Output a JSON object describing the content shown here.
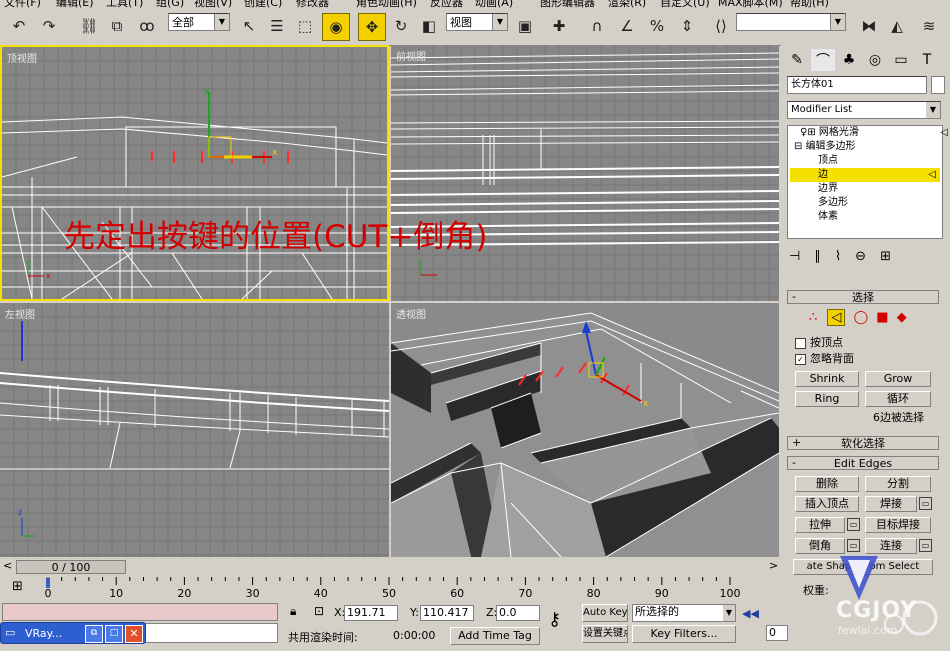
{
  "menu": [
    "文件(F)",
    "编辑(E)",
    "工具(T)",
    "组(G)",
    "视图(V)",
    "创建(C)",
    "修改器",
    "角色动画(H)",
    "反应器",
    "动画(A)",
    "图形编辑器",
    "渲染(R)",
    "自定义(U)",
    "MAX脚本(M)",
    "帮助(H)"
  ],
  "toolbar": {
    "selection_filter": "全部",
    "ref_coord": "视图",
    "named_selection": ""
  },
  "viewports": {
    "top_label": "顶视图",
    "front_label": "前视图",
    "left_label": "左视图",
    "persp_label": "透视图",
    "overlay_text": "先定出按键的位置(CUT+倒角)"
  },
  "command_panel": {
    "object_name": "长方体01",
    "modifier_list": "Modifier List",
    "stack": [
      "网格光滑",
      "编辑多边形",
      "顶点",
      "边",
      "边界",
      "多边形",
      "体素"
    ],
    "selection_rollout": "选择",
    "by_vertex": "按顶点",
    "ignore_backfacing": "忽略背面",
    "shrink": "Shrink",
    "grow": "Grow",
    "ring": "Ring",
    "loop": "循环",
    "selection_info": "6边被选择",
    "soft_selection": "软化选择",
    "edit_edges": "Edit Edges",
    "remove": "删除",
    "split": "分割",
    "insert_vertex": "插入顶点",
    "weld": "焊接",
    "extrude": "拉伸",
    "target_weld": "目标焊接",
    "chamfer": "倒角",
    "connect": "连接",
    "create_shape": "ate Shape From Select",
    "weight": "权重:"
  },
  "timeline": {
    "frame": "0 / 100",
    "ticks": [
      "0",
      "10",
      "20",
      "30",
      "40",
      "50",
      "60",
      "70",
      "80",
      "90",
      "100"
    ]
  },
  "status": {
    "x_label": "X:",
    "x_value": "191.71",
    "y_label": "Y:",
    "y_value": "110.417",
    "z_label": "Z:",
    "z_value": "0.0",
    "auto_key": "Auto Key",
    "set_key": "设置关键点",
    "selected": "所选择的",
    "key_filters": "Key Filters...",
    "render_time_label": "共用渲染时间:",
    "render_time": "0:00:00",
    "add_time_tag": "Add Time Tag",
    "frame_field": "0"
  },
  "taskbar": {
    "label": "VRay..."
  },
  "watermark": {
    "text": "CGJOY",
    "sub": "fewlai.com"
  },
  "colors": {
    "active_viewport": "#f5e000",
    "selected_edge": "#ff2a2a",
    "viewport_bg": "#868686"
  }
}
